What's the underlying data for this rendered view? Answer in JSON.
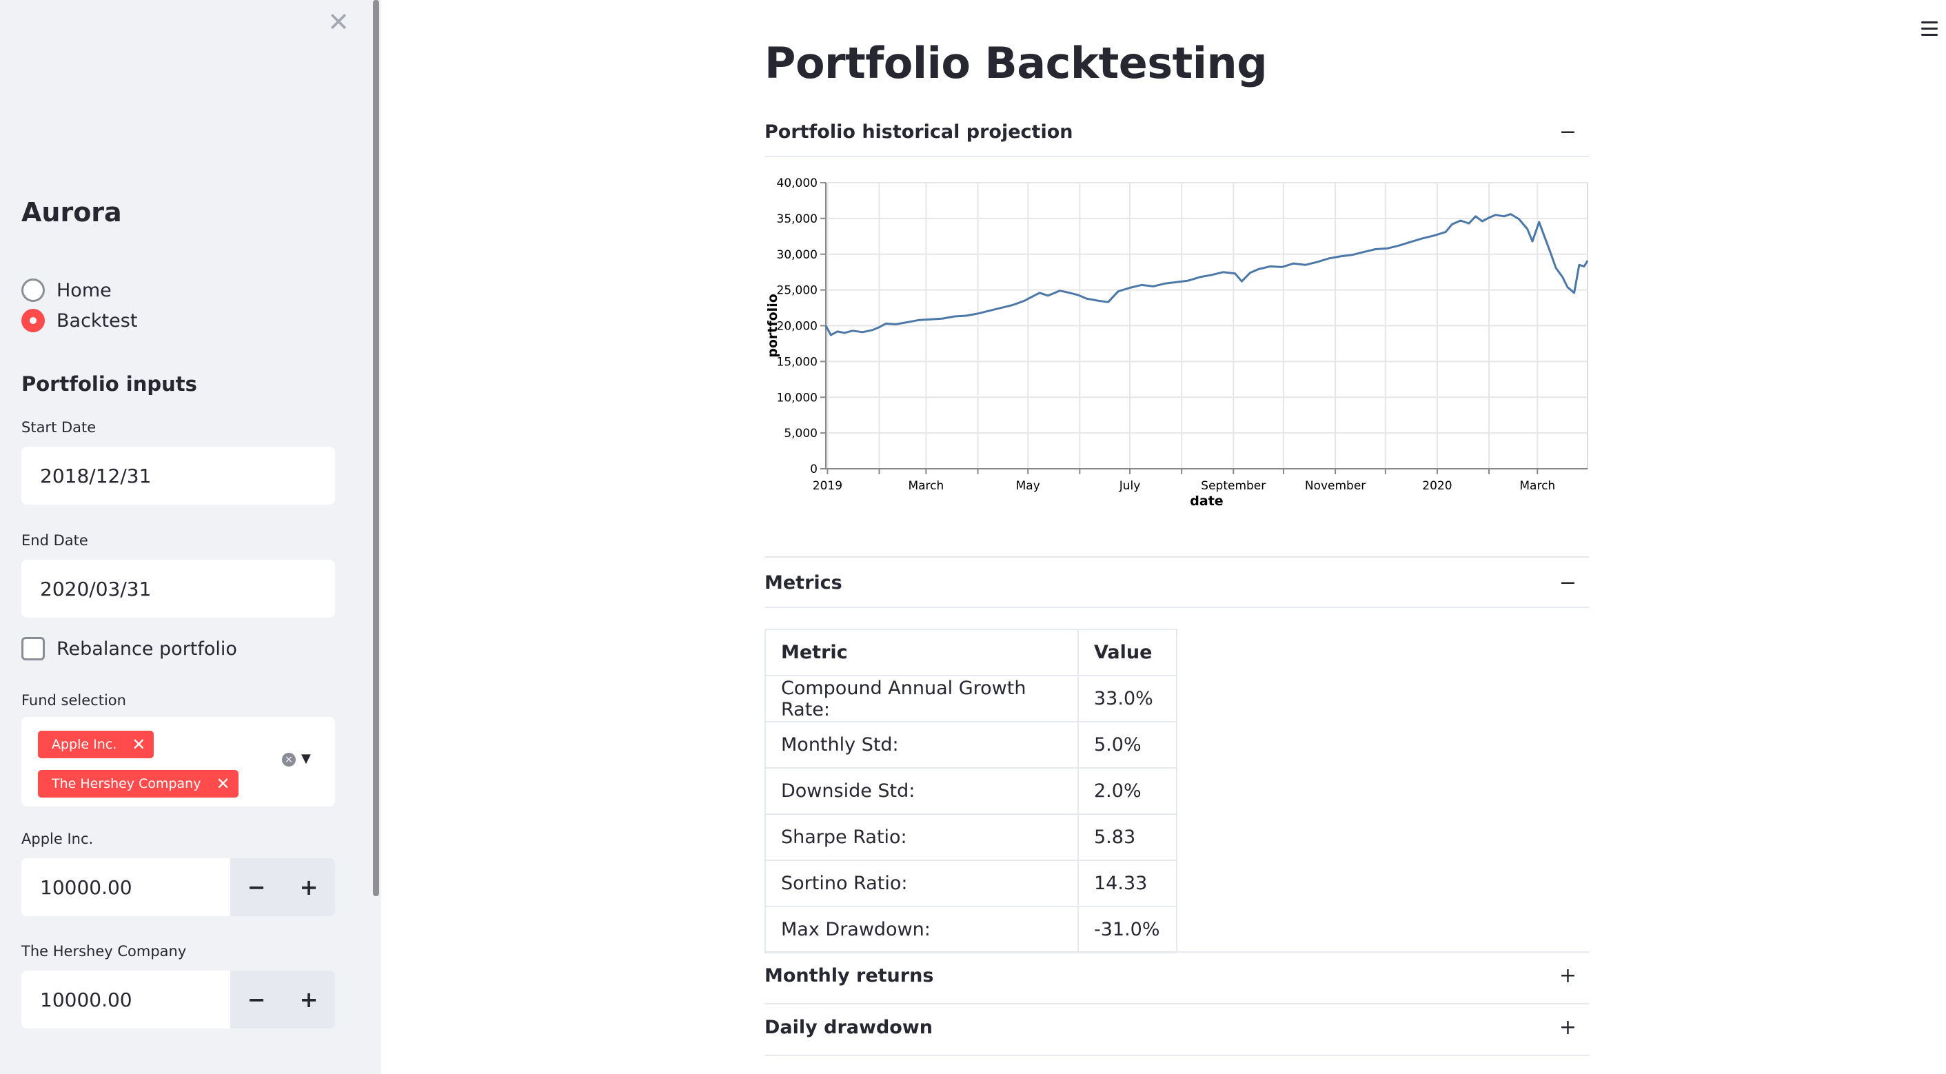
{
  "sidebar": {
    "close_icon": "close-icon",
    "app_title": "Aurora",
    "nav": [
      {
        "label": "Home",
        "selected": false
      },
      {
        "label": "Backtest",
        "selected": true
      }
    ],
    "section_title": "Portfolio inputs",
    "start_date": {
      "label": "Start Date",
      "value": "2018/12/31"
    },
    "end_date": {
      "label": "End Date",
      "value": "2020/03/31"
    },
    "rebalance": {
      "label": "Rebalance portfolio",
      "checked": false
    },
    "fund_selection": {
      "label": "Fund selection",
      "selected": [
        "Apple Inc.",
        "The Hershey Company"
      ],
      "tag_remove": "✕"
    },
    "fund_inputs": [
      {
        "label": "Apple Inc.",
        "value": "10000.00"
      },
      {
        "label": "The Hershey Company",
        "value": "10000.00"
      }
    ],
    "stepper": {
      "minus": "−",
      "plus": "+"
    }
  },
  "main": {
    "title": "Portfolio Backtesting",
    "expanders": [
      {
        "title": "Portfolio historical projection",
        "toggle": "−"
      },
      {
        "title": "Metrics",
        "toggle": "−"
      },
      {
        "title": "Monthly returns",
        "toggle": "+"
      },
      {
        "title": "Daily drawdown",
        "toggle": "+"
      }
    ],
    "metrics_table": {
      "headers": [
        "Metric",
        "Value"
      ],
      "rows": [
        [
          "Compound Annual Growth Rate:",
          "33.0%"
        ],
        [
          "Monthly Std:",
          "5.0%"
        ],
        [
          "Downside Std:",
          "2.0%"
        ],
        [
          "Sharpe Ratio:",
          "5.83"
        ],
        [
          "Sortino Ratio:",
          "14.33"
        ],
        [
          "Max Drawdown:",
          "-31.0%"
        ]
      ]
    }
  },
  "colors": {
    "accent": "#ff4b4b",
    "line": "#4c78a8",
    "sidebar_bg": "#f0f2f6"
  },
  "chart_data": {
    "type": "line",
    "xlabel": "date",
    "ylabel": "portfolio",
    "ylim": [
      0,
      40000
    ],
    "xlim": [
      "2018-12-31",
      "2020-03-31"
    ],
    "grid": true,
    "y_ticks": [
      "0",
      "5,000",
      "10,000",
      "15,000",
      "20,000",
      "25,000",
      "30,000",
      "35,000",
      "40,000"
    ],
    "x_ticks": [
      {
        "date": "2019-01-01",
        "label": "2019"
      },
      {
        "date": "2019-02-01",
        "label": ""
      },
      {
        "date": "2019-03-01",
        "label": "March"
      },
      {
        "date": "2019-04-01",
        "label": ""
      },
      {
        "date": "2019-05-01",
        "label": "May"
      },
      {
        "date": "2019-06-01",
        "label": ""
      },
      {
        "date": "2019-07-01",
        "label": "July"
      },
      {
        "date": "2019-08-01",
        "label": ""
      },
      {
        "date": "2019-09-01",
        "label": "September"
      },
      {
        "date": "2019-10-01",
        "label": ""
      },
      {
        "date": "2019-11-01",
        "label": "November"
      },
      {
        "date": "2019-12-01",
        "label": ""
      },
      {
        "date": "2020-01-01",
        "label": "2020"
      },
      {
        "date": "2020-02-01",
        "label": ""
      },
      {
        "date": "2020-03-01",
        "label": "March"
      }
    ],
    "series": [
      {
        "points": [
          [
            "2018-12-31",
            20000
          ],
          [
            "2019-01-03",
            18700
          ],
          [
            "2019-01-07",
            19200
          ],
          [
            "2019-01-11",
            19000
          ],
          [
            "2019-01-16",
            19300
          ],
          [
            "2019-01-22",
            19100
          ],
          [
            "2019-01-28",
            19400
          ],
          [
            "2019-02-01",
            19800
          ],
          [
            "2019-02-05",
            20300
          ],
          [
            "2019-02-11",
            20200
          ],
          [
            "2019-02-18",
            20500
          ],
          [
            "2019-02-25",
            20800
          ],
          [
            "2019-03-04",
            20900
          ],
          [
            "2019-03-11",
            21000
          ],
          [
            "2019-03-18",
            21300
          ],
          [
            "2019-03-25",
            21400
          ],
          [
            "2019-04-01",
            21700
          ],
          [
            "2019-04-08",
            22100
          ],
          [
            "2019-04-15",
            22500
          ],
          [
            "2019-04-22",
            22900
          ],
          [
            "2019-04-29",
            23500
          ],
          [
            "2019-05-03",
            24000
          ],
          [
            "2019-05-08",
            24600
          ],
          [
            "2019-05-13",
            24200
          ],
          [
            "2019-05-20",
            24900
          ],
          [
            "2019-05-24",
            24700
          ],
          [
            "2019-05-31",
            24300
          ],
          [
            "2019-06-05",
            23800
          ],
          [
            "2019-06-12",
            23500
          ],
          [
            "2019-06-18",
            23300
          ],
          [
            "2019-06-24",
            24800
          ],
          [
            "2019-07-01",
            25300
          ],
          [
            "2019-07-08",
            25700
          ],
          [
            "2019-07-15",
            25500
          ],
          [
            "2019-07-22",
            25900
          ],
          [
            "2019-07-29",
            26100
          ],
          [
            "2019-08-05",
            26300
          ],
          [
            "2019-08-12",
            26800
          ],
          [
            "2019-08-19",
            27100
          ],
          [
            "2019-08-26",
            27500
          ],
          [
            "2019-09-02",
            27300
          ],
          [
            "2019-09-06",
            26200
          ],
          [
            "2019-09-11",
            27400
          ],
          [
            "2019-09-16",
            27900
          ],
          [
            "2019-09-23",
            28300
          ],
          [
            "2019-09-30",
            28200
          ],
          [
            "2019-10-07",
            28700
          ],
          [
            "2019-10-14",
            28500
          ],
          [
            "2019-10-21",
            28900
          ],
          [
            "2019-10-28",
            29400
          ],
          [
            "2019-11-04",
            29700
          ],
          [
            "2019-11-11",
            29900
          ],
          [
            "2019-11-18",
            30300
          ],
          [
            "2019-11-25",
            30700
          ],
          [
            "2019-12-02",
            30800
          ],
          [
            "2019-12-09",
            31200
          ],
          [
            "2019-12-16",
            31700
          ],
          [
            "2019-12-23",
            32200
          ],
          [
            "2019-12-30",
            32600
          ],
          [
            "2020-01-06",
            33100
          ],
          [
            "2020-01-10",
            34200
          ],
          [
            "2020-01-15",
            34700
          ],
          [
            "2020-01-20",
            34300
          ],
          [
            "2020-01-24",
            35300
          ],
          [
            "2020-01-28",
            34600
          ],
          [
            "2020-02-01",
            35100
          ],
          [
            "2020-02-05",
            35500
          ],
          [
            "2020-02-10",
            35300
          ],
          [
            "2020-02-14",
            35600
          ],
          [
            "2020-02-19",
            34900
          ],
          [
            "2020-02-24",
            33500
          ],
          [
            "2020-02-27",
            31800
          ],
          [
            "2020-03-02",
            34500
          ],
          [
            "2020-03-05",
            32600
          ],
          [
            "2020-03-09",
            30100
          ],
          [
            "2020-03-12",
            28100
          ],
          [
            "2020-03-16",
            26800
          ],
          [
            "2020-03-19",
            25400
          ],
          [
            "2020-03-23",
            24600
          ],
          [
            "2020-03-26",
            28500
          ],
          [
            "2020-03-29",
            28300
          ],
          [
            "2020-03-31",
            29100
          ]
        ]
      }
    ]
  }
}
